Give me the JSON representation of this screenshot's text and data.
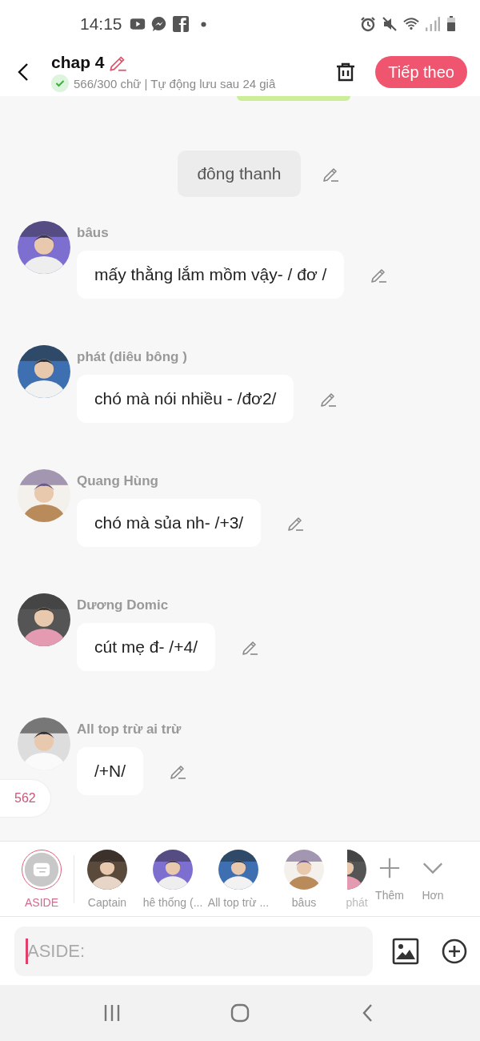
{
  "status_bar": {
    "time": "14:15"
  },
  "header": {
    "title": "chap 4",
    "saved": true,
    "info": "566/300 chữ | Tự động lưu sau 24 giâ",
    "next_button": "Tiếp theo"
  },
  "messages": [
    {
      "kind": "cut"
    },
    {
      "kind": "aside",
      "text": "đông thanh"
    },
    {
      "kind": "character",
      "name": "bâus",
      "text": "mấy thằng lắm mồm vậy- / đơ /"
    },
    {
      "kind": "character",
      "name": "phát (diêu bông )",
      "text": "chó mà nói nhiều - /đơ2/"
    },
    {
      "kind": "character",
      "name": "Quang Hùng",
      "text": "chó mà sủa nh- /+3/"
    },
    {
      "kind": "character",
      "name": "Dương Domic",
      "text": "cút mẹ đ- /+4/"
    },
    {
      "kind": "character",
      "name": "All top trừ ai trừ",
      "text": "/+N/"
    }
  ],
  "counter_badge": "562",
  "characters": [
    {
      "kind": "aside",
      "name": "ASIDE",
      "selected": true
    },
    {
      "name": "Captain",
      "selected": false
    },
    {
      "name": "hê thống (...",
      "selected": false
    },
    {
      "name": "All top trừ ...",
      "selected": false
    },
    {
      "name": "bâus",
      "selected": false
    },
    {
      "name": "phát",
      "selected": false
    }
  ],
  "strip_actions": [
    {
      "kind": "add",
      "label": "Thêm"
    },
    {
      "kind": "more",
      "label": "Hơn"
    }
  ],
  "input": {
    "placeholder": "ASIDE:"
  }
}
